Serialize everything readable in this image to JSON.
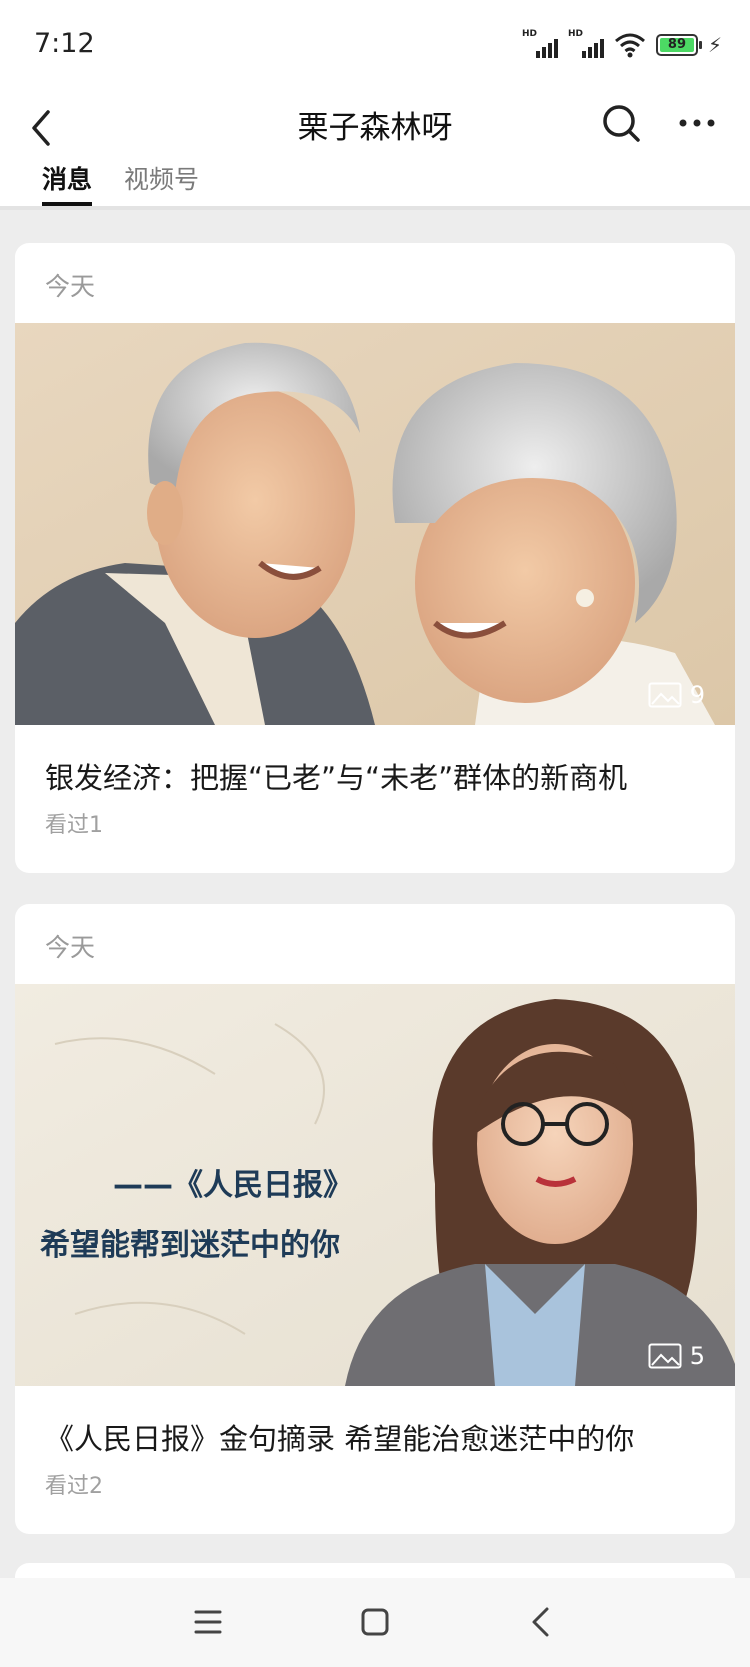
{
  "status_bar": {
    "time": "7:12",
    "battery": "89",
    "signal1_label": "HD",
    "signal2_label": "HD"
  },
  "header": {
    "title": "栗子森林呀",
    "tabs": [
      {
        "label": "消息",
        "active": true
      },
      {
        "label": "视频号",
        "active": false
      }
    ]
  },
  "articles": [
    {
      "date": "今天",
      "title": "银发经济：把握“已老”与“未老”群体的新商机",
      "views": "看过1",
      "image_count": "9"
    },
    {
      "date": "今天",
      "title": "《人民日报》金句摘录 希望能治愈迷茫中的你",
      "views": "看过2",
      "image_count": "5",
      "image_overlay_line1": "——《人民日报》",
      "image_overlay_line2": "希望能帮到迷茫中的你"
    }
  ],
  "colors": {
    "background": "#ededed",
    "card": "#ffffff",
    "battery_fill": "#4cd964",
    "overlay_text": "#1e3b57"
  }
}
